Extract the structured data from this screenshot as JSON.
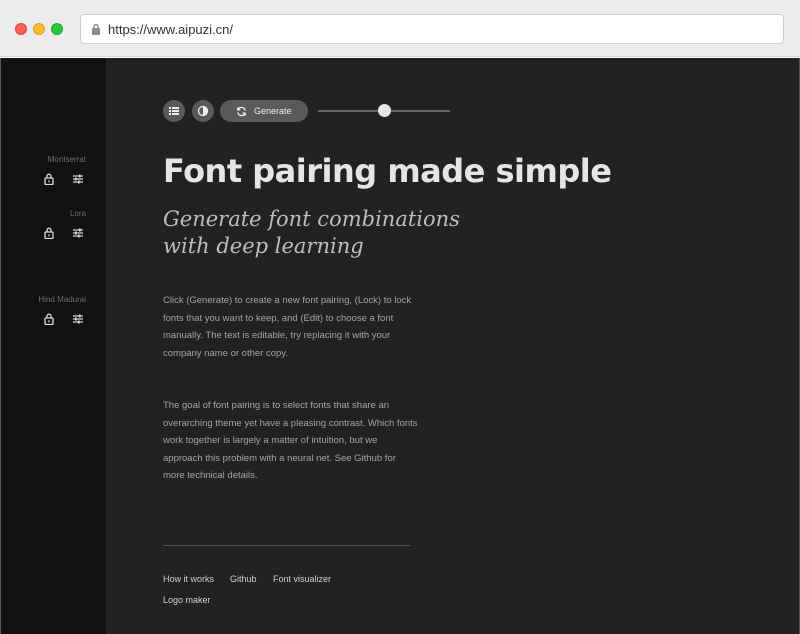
{
  "browser": {
    "url": "https://www.aipuzi.cn/"
  },
  "sidebar": {
    "fonts": [
      {
        "name": "Montserrat",
        "lock_icon": "unlock-icon",
        "edit_icon": "sliders-icon"
      },
      {
        "name": "Lora",
        "lock_icon": "unlock-icon",
        "edit_icon": "sliders-icon"
      },
      {
        "name": "Hind Madurai",
        "lock_icon": "unlock-icon",
        "edit_icon": "sliders-icon"
      }
    ]
  },
  "toolbar": {
    "list_icon": "list-icon",
    "contrast_icon": "contrast-icon",
    "generate_icon": "refresh-icon",
    "generate_label": "Generate",
    "slider_value": 0.5
  },
  "content": {
    "headline": "Font pairing made simple",
    "subheadline": "Generate font combinations with deep learning",
    "paragraphs": [
      "Click (Generate) to create a new font pairing, (Lock) to lock fonts that you want to keep, and (Edit) to choose a font manually. The text is editable, try replacing it with your company name or other copy.",
      "The goal of font pairing is to select fonts that share an overarching theme yet have a pleasing contrast. Which fonts work together is largely a matter of intuition, but we approach this problem with a neural net. See Github for more technical details."
    ]
  },
  "footer": {
    "links": [
      "How it works",
      "Github",
      "Font visualizer",
      "Logo maker"
    ]
  },
  "colors": {
    "background": "#222222",
    "sidebar": "#111111",
    "button": "#5a5a5a",
    "headline": "#e5e5e5"
  }
}
